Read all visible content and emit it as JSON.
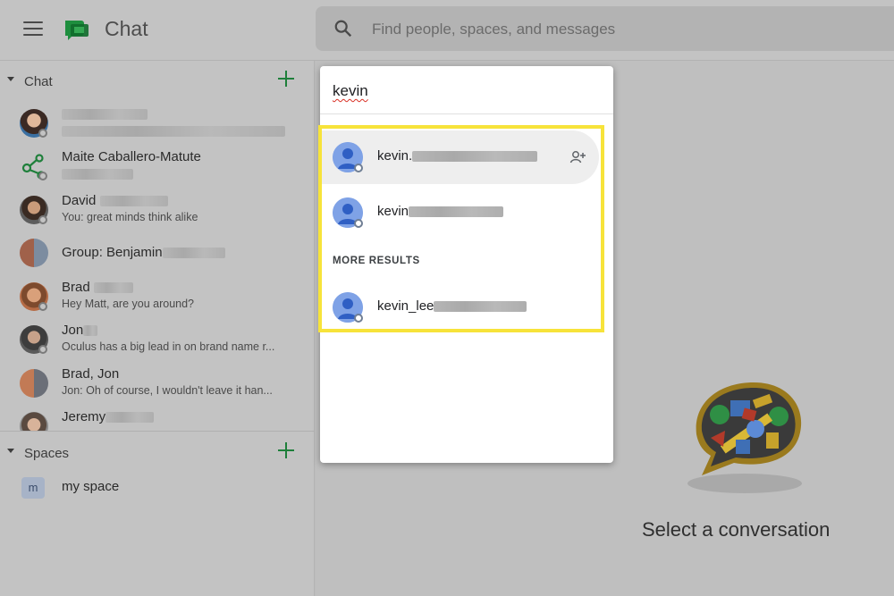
{
  "app": {
    "title": "Chat"
  },
  "search": {
    "placeholder": "Find people, spaces, and messages",
    "query": "kevin"
  },
  "sidebar": {
    "chat_section": {
      "label": "Chat"
    },
    "chats": [
      {
        "name": "",
        "preview": "",
        "avatar": "photo"
      },
      {
        "name": "Maite Caballero-Matute",
        "preview": "",
        "avatar": "network-icon"
      },
      {
        "name": "David",
        "preview": "You: great minds think alike",
        "avatar": "photo"
      },
      {
        "name": "Group: Benjamin",
        "preview": "",
        "avatar": "group-photo"
      },
      {
        "name": "Brad",
        "preview": "Hey Matt, are you around?",
        "avatar": "photo"
      },
      {
        "name": "Jon",
        "preview": "Oculus has a big lead in on brand name r...",
        "avatar": "photo"
      },
      {
        "name": "Brad, Jon",
        "preview": "Jon: Oh of course, I wouldn't leave it han...",
        "avatar": "group-photo"
      },
      {
        "name": "Jeremy",
        "preview": "",
        "avatar": "photo"
      }
    ],
    "spaces_section": {
      "label": "Spaces"
    },
    "spaces": [
      {
        "badge": "m",
        "label": "my space"
      }
    ]
  },
  "dropdown": {
    "results": [
      {
        "name": "kevin."
      },
      {
        "name": "kevin"
      }
    ],
    "more_results_label": "MORE RESULTS",
    "more_results": [
      {
        "name": "kevin_lee"
      }
    ]
  },
  "main": {
    "empty_state": "Select a conversation"
  },
  "colors": {
    "accent_green": "#1e7f3a",
    "highlight": "#f7e33a",
    "avatar_blue": "#7fa2e6"
  },
  "icons": [
    "menu-icon",
    "chat-logo-icon",
    "search-icon",
    "plus-icon",
    "add-person-icon",
    "person-avatar-icon",
    "conversation-illustration"
  ]
}
